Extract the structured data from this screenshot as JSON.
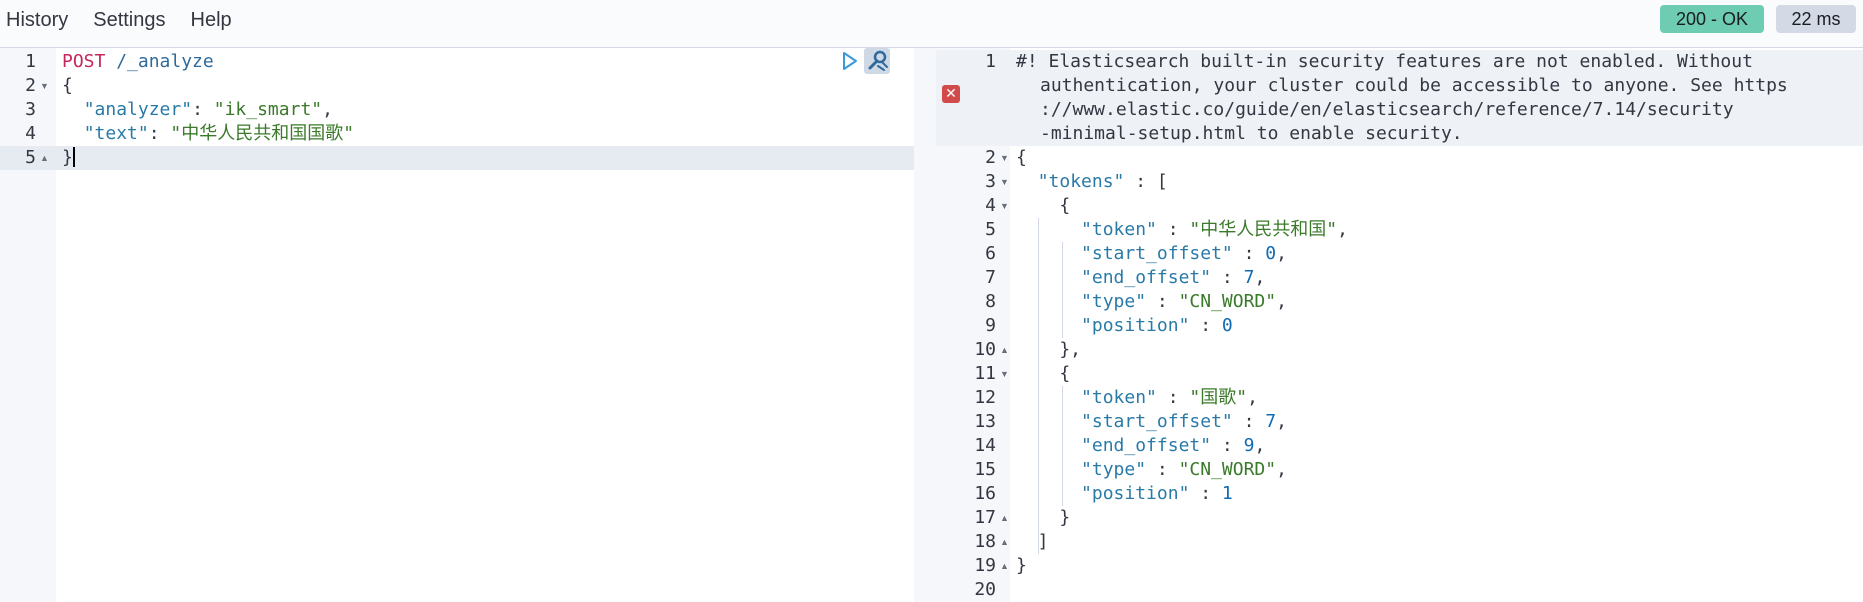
{
  "menu": {
    "history": "History",
    "settings": "Settings",
    "help": "Help"
  },
  "status": {
    "code": "200 - OK",
    "time": "22 ms"
  },
  "request": {
    "method": "POST",
    "url": "/_analyze",
    "lines": [
      {
        "num": "1"
      },
      {
        "num": "2",
        "brace": "{"
      },
      {
        "num": "3",
        "key": "\"analyzer\"",
        "value": "\"ik_smart\"",
        "trail": ","
      },
      {
        "num": "4",
        "key": "\"text\"",
        "value": "\"中华人民共和国国歌\"",
        "trail": ""
      },
      {
        "num": "5",
        "brace": "}"
      }
    ]
  },
  "response": {
    "warning_lines": [
      "#! Elasticsearch built-in security features are not enabled. Without",
      "authentication, your cluster could be accessible to anyone. See https",
      "://www.elastic.co/guide/en/elasticsearch/reference/7.14/security",
      "-minimal-setup.html to enable security."
    ],
    "line_numbers": [
      "1",
      "2",
      "3",
      "4",
      "5",
      "6",
      "7",
      "8",
      "9",
      "10",
      "11",
      "12",
      "13",
      "14",
      "15",
      "16",
      "17",
      "18",
      "19",
      "20"
    ],
    "tokens_key": "\"tokens\"",
    "tokens": [
      {
        "token": "\"中华人民共和国\"",
        "start_offset": "0",
        "end_offset": "7",
        "type": "\"CN_WORD\"",
        "position": "0"
      },
      {
        "token": "\"国歌\"",
        "start_offset": "7",
        "end_offset": "9",
        "type": "\"CN_WORD\"",
        "position": "1"
      }
    ],
    "keys": {
      "token": "\"token\"",
      "start_offset": "\"start_offset\"",
      "end_offset": "\"end_offset\"",
      "type": "\"type\"",
      "position": "\"position\""
    }
  },
  "icons": {
    "run": "play-icon",
    "wrench": "wrench-icon",
    "error": "error-x-icon"
  }
}
